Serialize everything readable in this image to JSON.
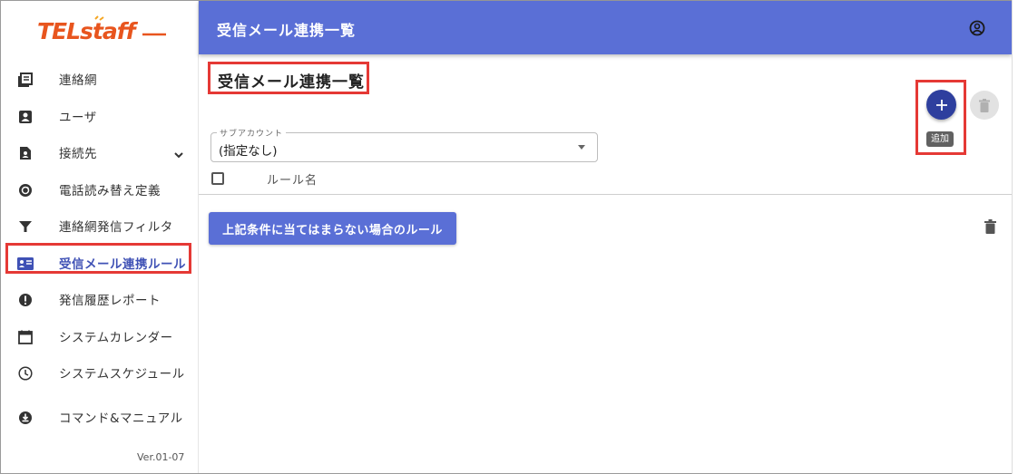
{
  "app": {
    "logo_text": "TELstaff",
    "brand_color": "#e8551e",
    "accent_color": "#5a6fd6",
    "version": "Ver.01-07"
  },
  "header": {
    "title": "受信メール連携一覧",
    "account_icon": "account-circle-icon"
  },
  "sidebar": {
    "items": [
      {
        "label": "連絡網",
        "icon": "contact-book-icon"
      },
      {
        "label": "ユーザ",
        "icon": "user-badge-icon"
      },
      {
        "label": "接続先",
        "icon": "file-person-icon",
        "expandable": true
      },
      {
        "label": "電話読み替え定義",
        "icon": "sync-circle-icon"
      },
      {
        "label": "連絡網発信フィルタ",
        "icon": "filter-icon"
      },
      {
        "label": "受信メール連携ルール",
        "icon": "id-card-icon",
        "active": true
      },
      {
        "label": "発信履歴レポート",
        "icon": "alert-circle-icon"
      },
      {
        "label": "システムカレンダー",
        "icon": "calendar-icon"
      },
      {
        "label": "システムスケジュール",
        "icon": "clock-icon"
      },
      {
        "label": "コマンド&マニュアル",
        "icon": "download-circle-icon"
      }
    ]
  },
  "main": {
    "title": "受信メール連携一覧",
    "add_tooltip": "追加",
    "subaccount": {
      "label": "サブアカウント",
      "value": "(指定なし)"
    },
    "table": {
      "column_header": "ルール名"
    },
    "default_rule_button": "上記条件に当てはまらない場合のルール"
  }
}
